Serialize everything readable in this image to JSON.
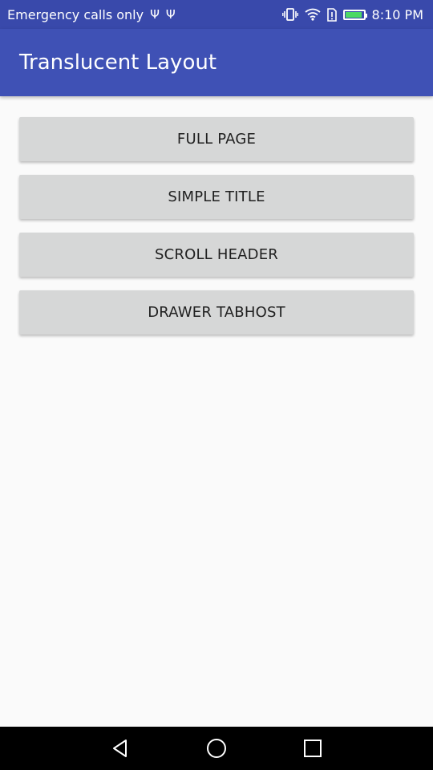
{
  "status_bar": {
    "carrier_text": "Emergency calls only",
    "usb_icon_1": "Ψ",
    "usb_icon_2": "Ψ",
    "time": "8:10 PM",
    "battery_level": 0.95,
    "icons": [
      "vibrate-icon",
      "wifi-icon",
      "sim-alert-icon",
      "battery-charging-icon"
    ]
  },
  "app_bar": {
    "title": "Translucent Layout",
    "color": "#3f51b5"
  },
  "buttons": [
    {
      "label": "FULL PAGE"
    },
    {
      "label": "SIMPLE TITLE"
    },
    {
      "label": "SCROLL HEADER"
    },
    {
      "label": "DRAWER TABHOST"
    }
  ],
  "nav_bar": {
    "icons": [
      "back-icon",
      "home-icon",
      "recents-icon"
    ]
  },
  "colors": {
    "status_bar": "#3949ab",
    "app_bar": "#3f51b5",
    "button": "#d6d7d7",
    "background": "#fafafa",
    "battery_fill": "#4cd964"
  }
}
